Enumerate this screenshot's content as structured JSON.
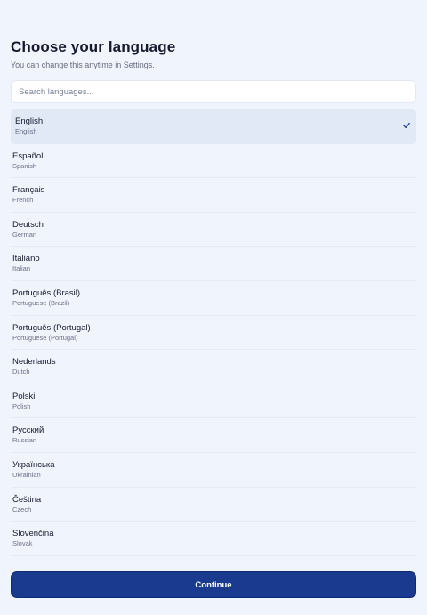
{
  "header": {
    "title": "Choose your language",
    "subtitle": "You can change this anytime in Settings."
  },
  "search": {
    "placeholder": "Search languages...",
    "value": ""
  },
  "languages": [
    {
      "native": "English",
      "english": "English",
      "selected": true
    },
    {
      "native": "Español",
      "english": "Spanish",
      "selected": false
    },
    {
      "native": "Français",
      "english": "French",
      "selected": false
    },
    {
      "native": "Deutsch",
      "english": "German",
      "selected": false
    },
    {
      "native": "Italiano",
      "english": "Italian",
      "selected": false
    },
    {
      "native": "Português (Brasil)",
      "english": "Portuguese (Brazil)",
      "selected": false
    },
    {
      "native": "Português (Portugal)",
      "english": "Portuguese (Portugal)",
      "selected": false
    },
    {
      "native": "Nederlands",
      "english": "Dutch",
      "selected": false
    },
    {
      "native": "Polski",
      "english": "Polish",
      "selected": false
    },
    {
      "native": "Русский",
      "english": "Russian",
      "selected": false
    },
    {
      "native": "Українська",
      "english": "Ukrainian",
      "selected": false
    },
    {
      "native": "Čeština",
      "english": "Czech",
      "selected": false
    },
    {
      "native": "Slovenčina",
      "english": "Slovak",
      "selected": false
    }
  ],
  "selected_icon": "check-icon",
  "footer": {
    "continue_label": "Continue"
  },
  "colors": {
    "background": "#f0f4fd",
    "selected_row": "#e1e8f6",
    "primary_button": "#1a3a8f",
    "text_primary": "#151a2e",
    "text_secondary": "#6a7086"
  }
}
